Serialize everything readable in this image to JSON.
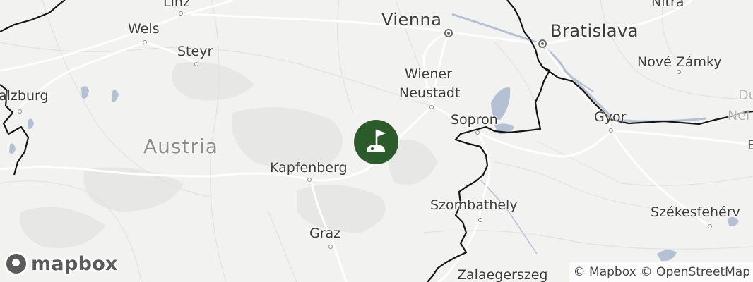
{
  "map": {
    "colors": {
      "land": "#f2f2f1",
      "relief": "#e6e6e5",
      "roads": "#ffffff",
      "minor_roads": "#e9e9e8",
      "border": "#111111",
      "water": "#aebbd0",
      "marker": "#2b5a2b"
    },
    "labels": {
      "country": "Austria",
      "capitals": [
        "Vienna",
        "Bratislava"
      ],
      "cities": {
        "linz": "Linz",
        "wels": "Wels",
        "steyr": "Steyr",
        "salzburg": "alzburg",
        "wiener_neustadt_1": "Wiener",
        "wiener_neustadt_2": "Neustadt",
        "sopron": "Sopron",
        "nitra": "Nitra",
        "nove_zamky": "Nové Zámky",
        "gyor": "Gyor",
        "kapfenberg": "Kapfenberg",
        "graz": "Graz",
        "szombathely": "Szombathely",
        "szekesfehervar": "Székesfehérv",
        "zalaegerszeg": "Zalaegerszeg",
        "dunajska_1": "Du",
        "dunajska_2": "Nei",
        "edge_e": "E"
      }
    },
    "marker": {
      "icon": "golf-flag-icon",
      "type": "golf-course"
    }
  },
  "branding": {
    "logo_text": "mapbox"
  },
  "attribution": {
    "mapbox": "© Mapbox",
    "osm": "© OpenStreetMap"
  }
}
